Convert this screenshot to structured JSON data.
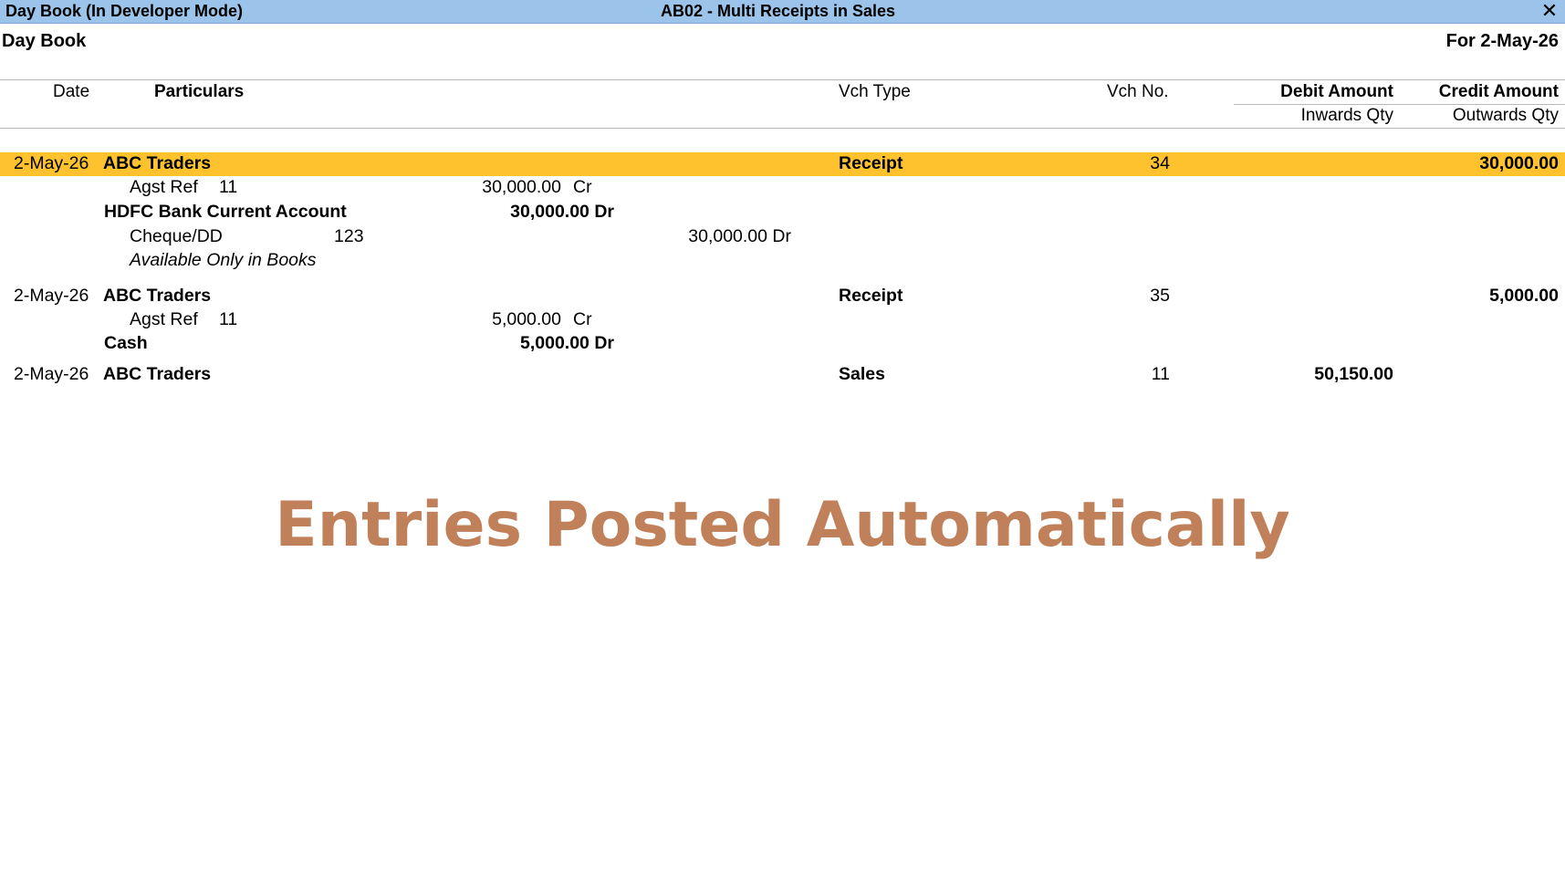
{
  "window": {
    "title_left": "Day Book (In Developer Mode)",
    "title_center": "AB02 - Multi Receipts in Sales",
    "close_symbol": "✕"
  },
  "report": {
    "name": "Day Book",
    "period": "For 2-May-26"
  },
  "columns": {
    "date": "Date",
    "particulars": "Particulars",
    "vch_type": "Vch Type",
    "vch_no": "Vch No.",
    "debit": "Debit Amount",
    "credit": "Credit Amount",
    "inwards": "Inwards Qty",
    "outwards": "Outwards Qty"
  },
  "vouchers": [
    {
      "date": "2-May-26",
      "party": "ABC Traders",
      "vch_type": "Receipt",
      "vch_no": "34",
      "credit": "30,000.00",
      "details": {
        "agst_label": "Agst Ref",
        "agst_ref": "11",
        "agst_amount": "30,000.00",
        "agst_side": "Cr",
        "ledger": "HDFC Bank Current Account",
        "ledger_amount": "30,000.00 Dr",
        "instrument": "Cheque/DD",
        "instrument_no": "123",
        "instrument_amount": "30,000.00 Dr",
        "note": "Available Only in Books"
      }
    },
    {
      "date": "2-May-26",
      "party": "ABC Traders",
      "vch_type": "Receipt",
      "vch_no": "35",
      "credit": "5,000.00",
      "details": {
        "agst_label": "Agst Ref",
        "agst_ref": "11",
        "agst_amount": "5,000.00",
        "agst_side": "Cr",
        "ledger": "Cash",
        "ledger_amount": "5,000.00 Dr"
      }
    },
    {
      "date": "2-May-26",
      "party": "ABC Traders",
      "vch_type": "Sales",
      "vch_no": "11",
      "debit": "50,150.00"
    }
  ],
  "overlay": {
    "text": "Entries Posted Automatically",
    "color": "#c0805a"
  },
  "colors": {
    "titlebar": "#9cc4ea",
    "selected_row": "#fdc22e"
  }
}
